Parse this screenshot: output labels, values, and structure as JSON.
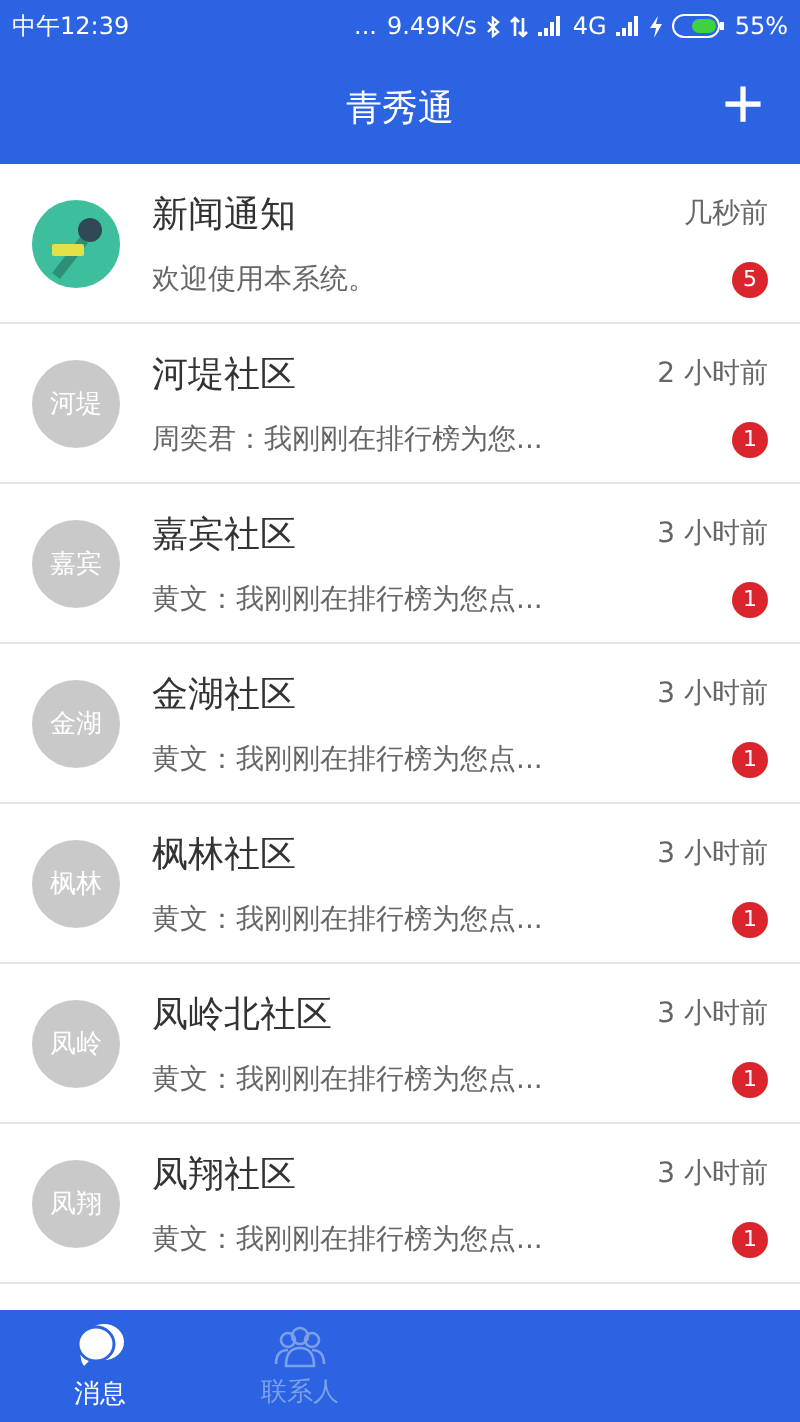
{
  "status_bar": {
    "time": "中午12:39",
    "dots": "...",
    "speed": "9.49K/s",
    "network": "4G",
    "battery": "55%"
  },
  "header": {
    "title": "青秀通",
    "add": "+"
  },
  "chats": [
    {
      "kind": "news",
      "name": "新闻通知",
      "time": "几秒前",
      "preview": "欢迎使用本系统。",
      "unread": "5"
    },
    {
      "kind": "initials",
      "avatar": "河堤",
      "name": "河堤社区",
      "time": "2 小时前",
      "preview": "周奕君：我刚刚在排行榜为您...",
      "unread": "1"
    },
    {
      "kind": "initials",
      "avatar": "嘉宾",
      "name": "嘉宾社区",
      "time": "3 小时前",
      "preview": "黄文：我刚刚在排行榜为您点...",
      "unread": "1"
    },
    {
      "kind": "initials",
      "avatar": "金湖",
      "name": "金湖社区",
      "time": "3 小时前",
      "preview": "黄文：我刚刚在排行榜为您点...",
      "unread": "1"
    },
    {
      "kind": "initials",
      "avatar": "枫林",
      "name": "枫林社区",
      "time": "3 小时前",
      "preview": "黄文：我刚刚在排行榜为您点...",
      "unread": "1"
    },
    {
      "kind": "initials",
      "avatar": "凤岭",
      "name": "凤岭北社区",
      "time": "3 小时前",
      "preview": "黄文：我刚刚在排行榜为您点...",
      "unread": "1"
    },
    {
      "kind": "initials",
      "avatar": "凤翔",
      "name": "凤翔社区",
      "time": "3 小时前",
      "preview": "黄文：我刚刚在排行榜为您点...",
      "unread": "1"
    }
  ],
  "tabs": [
    {
      "kind": "chat",
      "label": "消息",
      "selected": true
    },
    {
      "kind": "contacts",
      "label": "联系人",
      "selected": false
    }
  ]
}
